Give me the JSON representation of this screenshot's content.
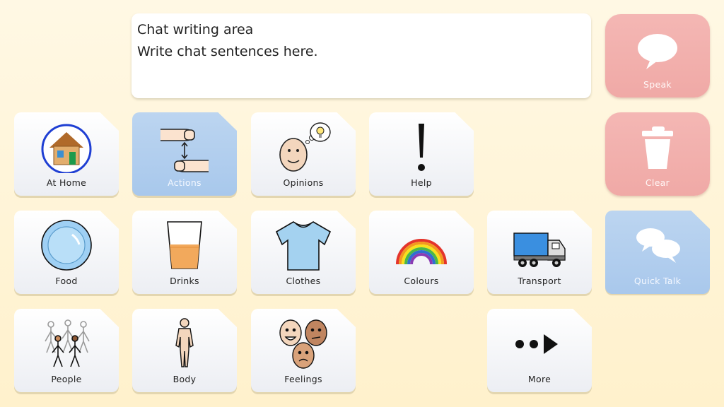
{
  "chat": {
    "line1": "Chat writing area",
    "line2": "Write chat sentences here."
  },
  "actions": {
    "speak_label": "Speak",
    "clear_label": "Clear",
    "quick_talk_label": "Quick Talk"
  },
  "tiles": {
    "at_home": "At Home",
    "actions": "Actions",
    "opinions": "Opinions",
    "help": "Help",
    "food": "Food",
    "drinks": "Drinks",
    "clothes": "Clothes",
    "colours": "Colours",
    "transport": "Transport",
    "people": "People",
    "body": "Body",
    "feelings": "Feelings",
    "more": "More"
  },
  "colors": {
    "tile_selected": "#a8c8ec",
    "action_red": "#f0a9a6",
    "background": "#fff3d2"
  }
}
